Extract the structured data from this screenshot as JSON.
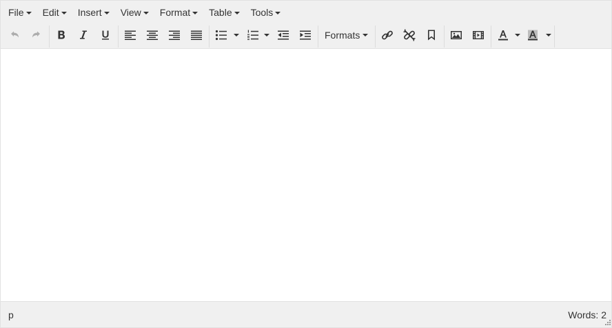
{
  "menubar": {
    "items": [
      "File",
      "Edit",
      "Insert",
      "View",
      "Format",
      "Table",
      "Tools"
    ]
  },
  "toolbar": {
    "formats_label": "Formats",
    "icons": [
      "undo-icon",
      "redo-icon",
      "bold-icon",
      "italic-icon",
      "underline-icon",
      "align-left-icon",
      "align-center-icon",
      "align-right-icon",
      "align-justify-icon",
      "bullet-list-icon",
      "numbered-list-icon",
      "outdent-icon",
      "indent-icon",
      "link-icon",
      "unlink-icon",
      "bookmark-icon",
      "image-icon",
      "media-icon",
      "text-color-icon",
      "background-color-icon"
    ],
    "disabled": [
      "undo",
      "redo"
    ]
  },
  "statusbar": {
    "path": "p",
    "word_count": "Words: 2"
  },
  "colors": {
    "chrome": "#f0f0f0",
    "border": "#e2e2e2",
    "text": "#333333"
  }
}
